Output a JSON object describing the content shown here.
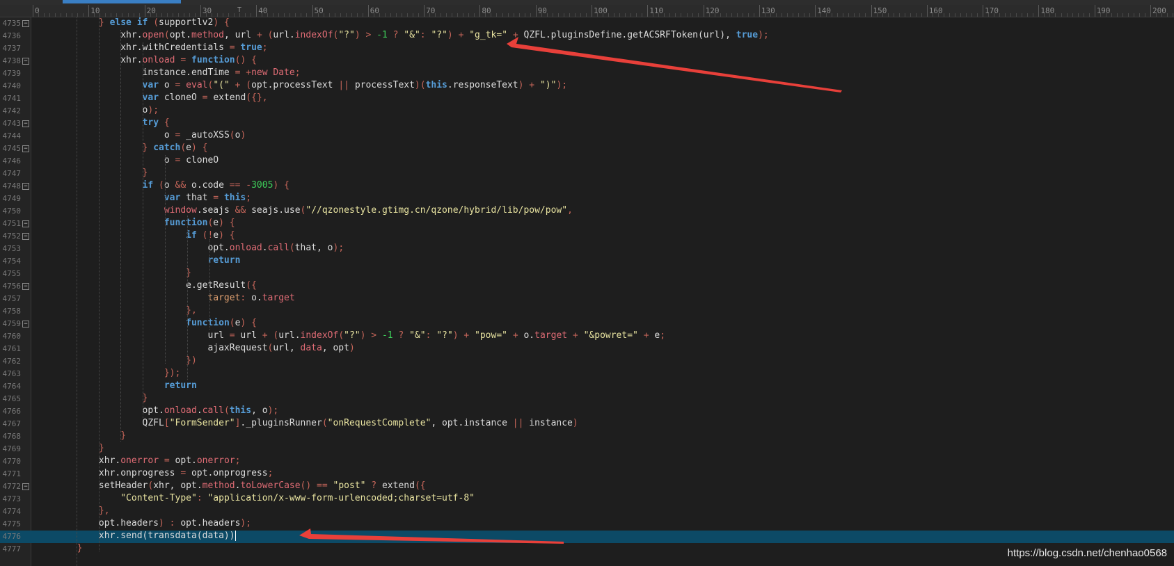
{
  "ruler": {
    "labels": [
      "0",
      "10",
      "20",
      "30",
      "40",
      "50",
      "60",
      "70",
      "80",
      "90",
      "100",
      "110",
      "120",
      "130",
      "140",
      "150",
      "160",
      "170",
      "180",
      "190",
      "200"
    ],
    "caret": "T"
  },
  "lines": [
    {
      "n": "4735",
      "fold": "−",
      "t": [
        [
          "u",
          "            "
        ],
        [
          "o",
          "} "
        ],
        [
          "k",
          "else if "
        ],
        [
          "o",
          "("
        ],
        [
          "u",
          "supportlv2"
        ],
        [
          "o",
          ") {"
        ]
      ]
    },
    {
      "n": "4736",
      "t": [
        [
          "u",
          "                xhr."
        ],
        [
          "p",
          "open"
        ],
        [
          "o",
          "("
        ],
        [
          "u",
          "opt."
        ],
        [
          "p",
          "method"
        ],
        [
          "u",
          ", url "
        ],
        [
          "o",
          "+ ("
        ],
        [
          "u",
          "url."
        ],
        [
          "p",
          "indexOf"
        ],
        [
          "o",
          "("
        ],
        [
          "s",
          "\"?\""
        ],
        [
          "o",
          ") > "
        ],
        [
          "n",
          "-1"
        ],
        [
          "o",
          " ? "
        ],
        [
          "s",
          "\"&\""
        ],
        [
          "o",
          ": "
        ],
        [
          "s",
          "\"?\""
        ],
        [
          "o",
          ") + "
        ],
        [
          "s",
          "\"g_tk=\""
        ],
        [
          "o",
          " + "
        ],
        [
          "u",
          "QZFL.pluginsDefine.getACSRFToken(url), "
        ],
        [
          "k",
          "true"
        ],
        [
          "o",
          ");"
        ]
      ]
    },
    {
      "n": "4737",
      "t": [
        [
          "u",
          "                xhr.withCredentials "
        ],
        [
          "o",
          "= "
        ],
        [
          "k",
          "true"
        ],
        [
          "o",
          ";"
        ]
      ]
    },
    {
      "n": "4738",
      "fold": "−",
      "t": [
        [
          "u",
          "                xhr."
        ],
        [
          "p",
          "onload"
        ],
        [
          "o",
          " = "
        ],
        [
          "k",
          "function"
        ],
        [
          "o",
          "() {"
        ]
      ]
    },
    {
      "n": "4739",
      "t": [
        [
          "u",
          "                    instance.endTime "
        ],
        [
          "o",
          "= +"
        ],
        [
          "p",
          "new Date"
        ],
        [
          "o",
          ";"
        ]
      ]
    },
    {
      "n": "4740",
      "t": [
        [
          "u",
          "                    "
        ],
        [
          "k",
          "var "
        ],
        [
          "u",
          "o "
        ],
        [
          "o",
          "= "
        ],
        [
          "p",
          "eval"
        ],
        [
          "o",
          "("
        ],
        [
          "s",
          "\"(\""
        ],
        [
          "o",
          " + ("
        ],
        [
          "u",
          "opt.processText "
        ],
        [
          "o",
          "|| "
        ],
        [
          "u",
          "processText"
        ],
        [
          "o",
          ")("
        ],
        [
          "k",
          "this"
        ],
        [
          "u",
          ".responseText"
        ],
        [
          "o",
          ") + "
        ],
        [
          "s",
          "\")\""
        ],
        [
          "o",
          ");"
        ]
      ]
    },
    {
      "n": "4741",
      "t": [
        [
          "u",
          "                    "
        ],
        [
          "k",
          "var "
        ],
        [
          "u",
          "cloneO "
        ],
        [
          "o",
          "= "
        ],
        [
          "u",
          "extend"
        ],
        [
          "o",
          "({},"
        ]
      ]
    },
    {
      "n": "4742",
      "t": [
        [
          "u",
          "                    o"
        ],
        [
          "o",
          ");"
        ]
      ]
    },
    {
      "n": "4743",
      "fold": "−",
      "t": [
        [
          "u",
          "                    "
        ],
        [
          "k",
          "try"
        ],
        [
          "o",
          " {"
        ]
      ]
    },
    {
      "n": "4744",
      "t": [
        [
          "u",
          "                        o "
        ],
        [
          "o",
          "= "
        ],
        [
          "u",
          "_autoXSS"
        ],
        [
          "o",
          "("
        ],
        [
          "u",
          "o"
        ],
        [
          "o",
          ")"
        ]
      ]
    },
    {
      "n": "4745",
      "fold": "−",
      "t": [
        [
          "u",
          "                    "
        ],
        [
          "o",
          "} "
        ],
        [
          "k",
          "catch"
        ],
        [
          "o",
          "("
        ],
        [
          "u",
          "e"
        ],
        [
          "o",
          ") {"
        ]
      ]
    },
    {
      "n": "4746",
      "t": [
        [
          "u",
          "                        o "
        ],
        [
          "o",
          "= "
        ],
        [
          "u",
          "cloneO"
        ]
      ]
    },
    {
      "n": "4747",
      "t": [
        [
          "u",
          "                    "
        ],
        [
          "o",
          "}"
        ]
      ]
    },
    {
      "n": "4748",
      "fold": "−",
      "t": [
        [
          "u",
          "                    "
        ],
        [
          "k",
          "if "
        ],
        [
          "o",
          "("
        ],
        [
          "u",
          "o "
        ],
        [
          "o",
          "&& "
        ],
        [
          "u",
          "o.code "
        ],
        [
          "o",
          "== -"
        ],
        [
          "n",
          "3005"
        ],
        [
          "o",
          ") {"
        ]
      ]
    },
    {
      "n": "4749",
      "t": [
        [
          "u",
          "                        "
        ],
        [
          "k",
          "var "
        ],
        [
          "u",
          "that "
        ],
        [
          "o",
          "= "
        ],
        [
          "k",
          "this"
        ],
        [
          "o",
          ";"
        ]
      ]
    },
    {
      "n": "4750",
      "t": [
        [
          "u",
          "                        "
        ],
        [
          "p",
          "window"
        ],
        [
          "u",
          ".seajs "
        ],
        [
          "o",
          "&& "
        ],
        [
          "u",
          "seajs.use"
        ],
        [
          "o",
          "("
        ],
        [
          "s",
          "\"//qzonestyle.gtimg.cn/qzone/hybrid/lib/pow/pow\""
        ],
        [
          "o",
          ","
        ]
      ]
    },
    {
      "n": "4751",
      "fold": "−",
      "t": [
        [
          "u",
          "                        "
        ],
        [
          "k",
          "function"
        ],
        [
          "o",
          "("
        ],
        [
          "u",
          "e"
        ],
        [
          "o",
          ") {"
        ]
      ]
    },
    {
      "n": "4752",
      "fold": "−",
      "t": [
        [
          "u",
          "                            "
        ],
        [
          "k",
          "if "
        ],
        [
          "o",
          "(!"
        ],
        [
          "u",
          "e"
        ],
        [
          "o",
          ") {"
        ]
      ]
    },
    {
      "n": "4753",
      "t": [
        [
          "u",
          "                                opt."
        ],
        [
          "p",
          "onload"
        ],
        [
          "u",
          "."
        ],
        [
          "p",
          "call"
        ],
        [
          "o",
          "("
        ],
        [
          "u",
          "that, o"
        ],
        [
          "o",
          ");"
        ]
      ]
    },
    {
      "n": "4754",
      "t": [
        [
          "u",
          "                                "
        ],
        [
          "k",
          "return"
        ]
      ]
    },
    {
      "n": "4755",
      "t": [
        [
          "u",
          "                            "
        ],
        [
          "o",
          "}"
        ]
      ]
    },
    {
      "n": "4756",
      "fold": "−",
      "t": [
        [
          "u",
          "                            e.getResult"
        ],
        [
          "o",
          "({"
        ]
      ]
    },
    {
      "n": "4757",
      "t": [
        [
          "u",
          "                                "
        ],
        [
          "f",
          "target"
        ],
        [
          "o",
          ": "
        ],
        [
          "u",
          "o."
        ],
        [
          "p",
          "target"
        ]
      ]
    },
    {
      "n": "4758",
      "t": [
        [
          "u",
          "                            "
        ],
        [
          "o",
          "},"
        ]
      ]
    },
    {
      "n": "4759",
      "fold": "−",
      "t": [
        [
          "u",
          "                            "
        ],
        [
          "k",
          "function"
        ],
        [
          "o",
          "("
        ],
        [
          "u",
          "e"
        ],
        [
          "o",
          ") {"
        ]
      ]
    },
    {
      "n": "4760",
      "t": [
        [
          "u",
          "                                url "
        ],
        [
          "o",
          "= "
        ],
        [
          "u",
          "url "
        ],
        [
          "o",
          "+ ("
        ],
        [
          "u",
          "url."
        ],
        [
          "p",
          "indexOf"
        ],
        [
          "o",
          "("
        ],
        [
          "s",
          "\"?\""
        ],
        [
          "o",
          ") > "
        ],
        [
          "n",
          "-1"
        ],
        [
          "o",
          " ? "
        ],
        [
          "s",
          "\"&\""
        ],
        [
          "o",
          ": "
        ],
        [
          "s",
          "\"?\""
        ],
        [
          "o",
          ") + "
        ],
        [
          "s",
          "\"pow=\""
        ],
        [
          "o",
          " + "
        ],
        [
          "u",
          "o."
        ],
        [
          "p",
          "target"
        ],
        [
          "o",
          " + "
        ],
        [
          "s",
          "\"&powret=\""
        ],
        [
          "o",
          " + "
        ],
        [
          "u",
          "e"
        ],
        [
          "o",
          ";"
        ]
      ]
    },
    {
      "n": "4761",
      "t": [
        [
          "u",
          "                                ajaxRequest"
        ],
        [
          "o",
          "("
        ],
        [
          "u",
          "url, "
        ],
        [
          "p",
          "data"
        ],
        [
          "u",
          ", opt"
        ],
        [
          "o",
          ")"
        ]
      ]
    },
    {
      "n": "4762",
      "t": [
        [
          "u",
          "                            "
        ],
        [
          "o",
          "})"
        ]
      ]
    },
    {
      "n": "4763",
      "t": [
        [
          "u",
          "                        "
        ],
        [
          "o",
          "});"
        ]
      ]
    },
    {
      "n": "4764",
      "t": [
        [
          "u",
          "                        "
        ],
        [
          "k",
          "return"
        ]
      ]
    },
    {
      "n": "4765",
      "t": [
        [
          "u",
          "                    "
        ],
        [
          "o",
          "}"
        ]
      ]
    },
    {
      "n": "4766",
      "t": [
        [
          "u",
          "                    opt."
        ],
        [
          "p",
          "onload"
        ],
        [
          "u",
          "."
        ],
        [
          "p",
          "call"
        ],
        [
          "o",
          "("
        ],
        [
          "k",
          "this"
        ],
        [
          "u",
          ", o"
        ],
        [
          "o",
          ");"
        ]
      ]
    },
    {
      "n": "4767",
      "t": [
        [
          "u",
          "                    QZFL"
        ],
        [
          "o",
          "["
        ],
        [
          "s",
          "\"FormSender\""
        ],
        [
          "o",
          "]"
        ],
        [
          "u",
          "._pluginsRunner"
        ],
        [
          "o",
          "("
        ],
        [
          "s",
          "\"onRequestComplete\""
        ],
        [
          "u",
          ", opt.instance "
        ],
        [
          "o",
          "|| "
        ],
        [
          "u",
          "instance"
        ],
        [
          "o",
          ")"
        ]
      ]
    },
    {
      "n": "4768",
      "t": [
        [
          "u",
          "                "
        ],
        [
          "o",
          "}"
        ]
      ]
    },
    {
      "n": "4769",
      "t": [
        [
          "u",
          "            "
        ],
        [
          "o",
          "}"
        ]
      ]
    },
    {
      "n": "4770",
      "t": [
        [
          "u",
          "            xhr."
        ],
        [
          "p",
          "onerror"
        ],
        [
          "o",
          " = "
        ],
        [
          "u",
          "opt."
        ],
        [
          "p",
          "onerror"
        ],
        [
          "o",
          ";"
        ]
      ]
    },
    {
      "n": "4771",
      "t": [
        [
          "u",
          "            xhr.onprogress "
        ],
        [
          "o",
          "= "
        ],
        [
          "u",
          "opt.onprogress"
        ],
        [
          "o",
          ";"
        ]
      ]
    },
    {
      "n": "4772",
      "fold": "−",
      "t": [
        [
          "u",
          "            setHeader"
        ],
        [
          "o",
          "("
        ],
        [
          "u",
          "xhr, opt."
        ],
        [
          "p",
          "method"
        ],
        [
          "u",
          "."
        ],
        [
          "p",
          "toLowerCase"
        ],
        [
          "o",
          "() == "
        ],
        [
          "s",
          "\"post\""
        ],
        [
          "o",
          " ? "
        ],
        [
          "u",
          "extend"
        ],
        [
          "o",
          "({"
        ]
      ]
    },
    {
      "n": "4773",
      "t": [
        [
          "u",
          "                "
        ],
        [
          "s",
          "\"Content-Type\""
        ],
        [
          "o",
          ": "
        ],
        [
          "s",
          "\"application/x-www-form-urlencoded;charset=utf-8\""
        ]
      ]
    },
    {
      "n": "4774",
      "t": [
        [
          "u",
          "            "
        ],
        [
          "o",
          "},"
        ]
      ]
    },
    {
      "n": "4775",
      "t": [
        [
          "u",
          "            opt.headers"
        ],
        [
          "o",
          ") : "
        ],
        [
          "u",
          "opt.headers"
        ],
        [
          "o",
          ");"
        ]
      ]
    },
    {
      "n": "4776",
      "hl": true,
      "t": [
        [
          "u",
          "            xhr.send(transdata(data))"
        ]
      ]
    },
    {
      "n": "4777",
      "t": [
        [
          "u",
          "        "
        ],
        [
          "o",
          "}"
        ]
      ]
    }
  ],
  "watermark": "https://blog.csdn.net/chenhao0568",
  "colors": {
    "arrow": "#e8403a",
    "highlight": "#0c4a66",
    "background": "#1e1e1e"
  }
}
